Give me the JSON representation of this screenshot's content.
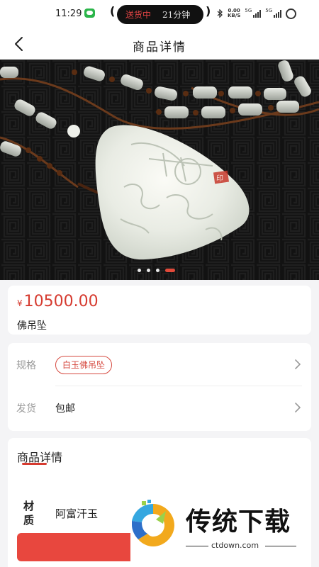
{
  "status_bar": {
    "time": "11:29",
    "delivery_status": "送货中",
    "delivery_time": "21分钟",
    "net_speed_value": "0.00",
    "net_speed_unit": "KB/S",
    "signal_1": "5G",
    "signal_2": "5G"
  },
  "nav": {
    "title": "商品详情"
  },
  "carousel": {
    "dot_count": 4,
    "active_index": 3
  },
  "product": {
    "currency_symbol": "¥",
    "price": "10500.00",
    "name": "佛吊坠"
  },
  "spec": {
    "label": "规格",
    "selected": "白玉佛吊坠"
  },
  "shipping": {
    "label": "发货",
    "value": "包邮"
  },
  "details": {
    "heading": "商品详情",
    "attributes": [
      {
        "label": "材质",
        "value": "阿富汗玉"
      }
    ]
  },
  "watermark": {
    "brand": "传统下载",
    "url": "ctdown.com"
  },
  "colors": {
    "accent": "#d63b30",
    "buy_button": "#e8473e",
    "wechat": "#2bb54a"
  }
}
